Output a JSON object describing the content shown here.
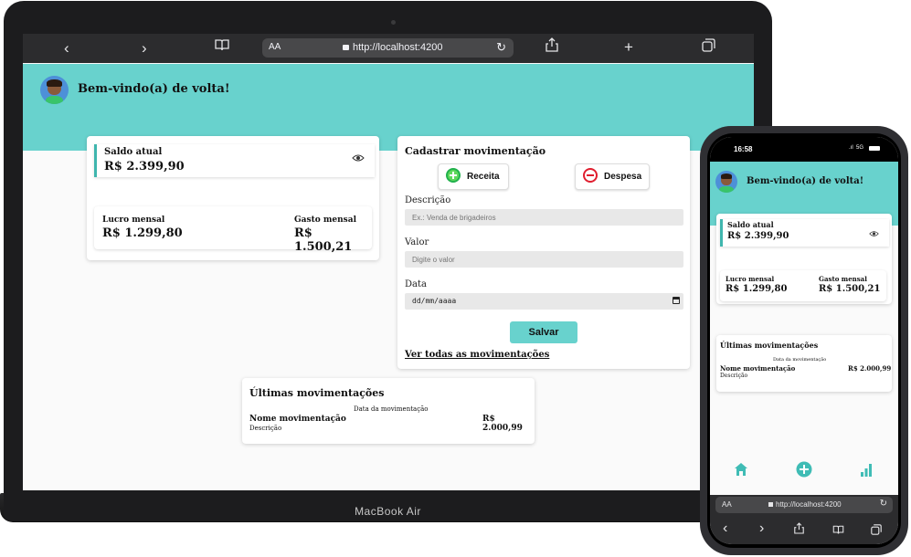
{
  "colors": {
    "accent": "#68d2cd",
    "income": "#21b14c",
    "expense": "#e01e2f"
  },
  "laptop": {
    "device_label": "MacBook Air",
    "browser": {
      "aa": "AA",
      "url": "http://localhost:4200",
      "back": "‹",
      "forward": "›",
      "add": "+",
      "share_icon": "share-icon",
      "book_icon": "book-icon",
      "tabs_icon": "tabs-icon"
    },
    "welcome": "Bem-vindo(a) de volta!",
    "saldo": {
      "label": "Saldo atual",
      "value": "R$ 2.399,90"
    },
    "lucro": {
      "label": "Lucro mensal",
      "value": "R$ 1.299,80"
    },
    "gasto": {
      "label": "Gasto mensal",
      "value": "R$ 1.500,21"
    },
    "form": {
      "title": "Cadastrar movimentação",
      "receita": "Receita",
      "despesa": "Despesa",
      "descricao_label": "Descrição",
      "descricao_placeholder": "Ex.: Venda de brigadeiros",
      "valor_label": "Valor",
      "valor_placeholder": "Digite o valor",
      "data_label": "Data",
      "data_placeholder": "dd/mm/aaaa",
      "save": "Salvar",
      "ver_todas": "Ver todas as movimentações"
    },
    "ultimas": {
      "title": "Últimas movimentações",
      "date": "Data da movimentação",
      "name": "Nome movimentação",
      "desc": "Descrição",
      "amount": "R$ 2.000,99"
    }
  },
  "phone": {
    "time": "16:58",
    "signal": "5G",
    "welcome": "Bem-vindo(a) de volta!",
    "saldo": {
      "label": "Saldo atual",
      "value": "R$ 2.399,90"
    },
    "lucro": {
      "label": "Lucro mensal",
      "value": "R$ 1.299,80"
    },
    "gasto": {
      "label": "Gasto mensal",
      "value": "R$ 1.500,21"
    },
    "ultimas": {
      "title": "Últimas movimentações",
      "date": "Data da movimentação",
      "name": "Nome movimentação",
      "desc": "Descrição",
      "amount": "R$ 2.000,99"
    },
    "browser": {
      "aa": "AA",
      "url": "http://localhost:4200",
      "back": "‹",
      "forward": "›"
    }
  }
}
